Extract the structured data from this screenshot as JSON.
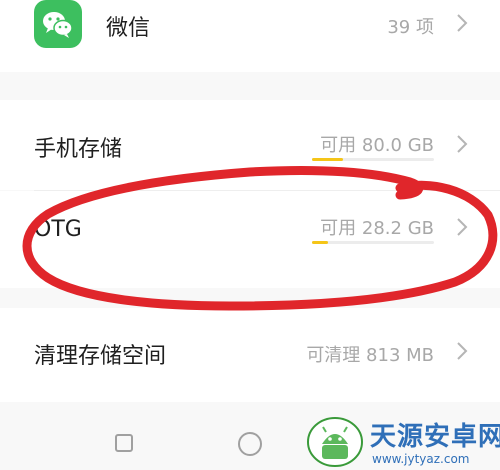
{
  "storage_list": {
    "items": [
      {
        "label": "微信",
        "value": "39 项",
        "has_icon": true,
        "icon": "wechat-icon"
      },
      {
        "label": "手机存储",
        "value": "可用 80.0 GB",
        "usage_fraction": 0.25
      },
      {
        "label": "OTG",
        "value": "可用 28.2 GB",
        "usage_fraction": 0.13
      },
      {
        "label": "清理存储空间",
        "value": "可清理 813 MB"
      }
    ],
    "bar_color": "#f5c518"
  },
  "annotation": {
    "stroke_color": "#e0262b"
  },
  "navbar": {
    "icons": [
      "recent-apps-icon",
      "home-icon"
    ]
  },
  "watermark": {
    "name": "天源安卓网",
    "url": "www.jytyaz.com"
  },
  "colors": {
    "wechat_green": "#3dbf5f",
    "text": "#1f1f1f",
    "muted": "#a8a8a8"
  }
}
